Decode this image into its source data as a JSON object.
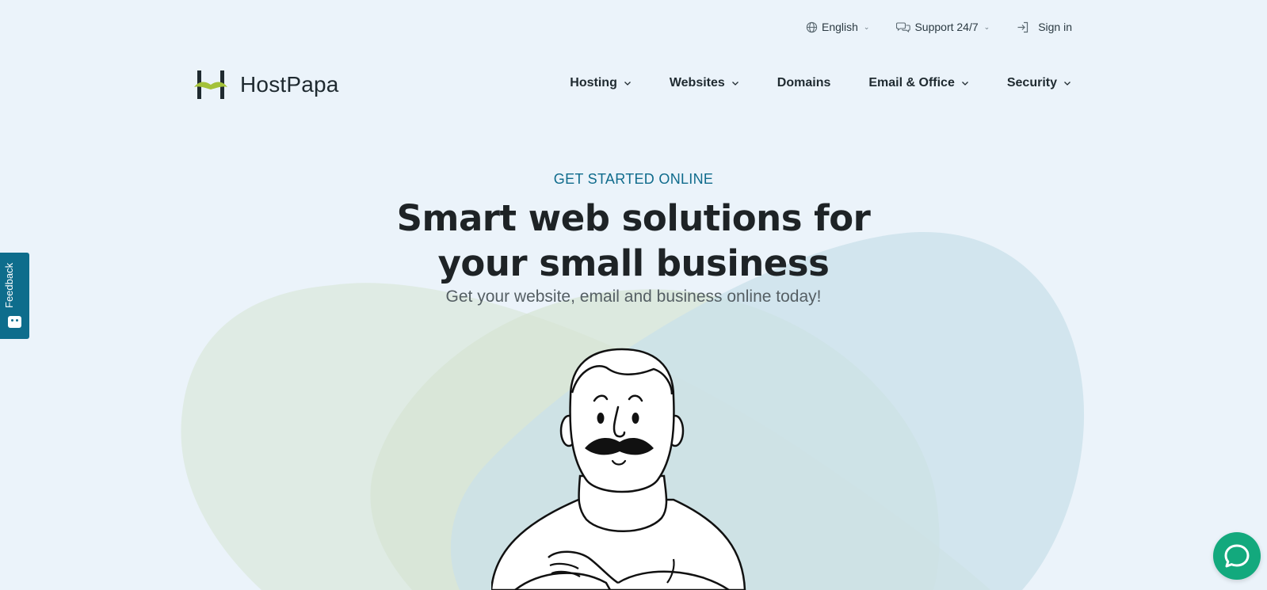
{
  "utility": {
    "language_label": "English",
    "support_label": "Support 24/7",
    "signin_label": "Sign in"
  },
  "brand": {
    "name": "HostPapa",
    "colors": {
      "accent_green": "#a4c23a",
      "dark": "#1f2a30",
      "teal": "#0f6b8c",
      "chat_green": "#13a97d"
    }
  },
  "nav": {
    "items": [
      {
        "label": "Hosting",
        "has_dropdown": true
      },
      {
        "label": "Websites",
        "has_dropdown": true
      },
      {
        "label": "Domains",
        "has_dropdown": false
      },
      {
        "label": "Email & Office",
        "has_dropdown": true
      },
      {
        "label": "Security",
        "has_dropdown": true
      }
    ]
  },
  "hero": {
    "eyebrow": "GET STARTED ONLINE",
    "headline_line1": "Smart web solutions for",
    "headline_line2": "your small business",
    "subheadline": "Get your website, email and business online today!"
  },
  "feedback": {
    "label": "Feedback"
  },
  "icons": {
    "language": "globe-icon",
    "support": "chat-bubbles-icon",
    "signin": "sign-in-icon",
    "chat": "chat-bubble-icon",
    "feedback": "feedback-face-icon"
  }
}
